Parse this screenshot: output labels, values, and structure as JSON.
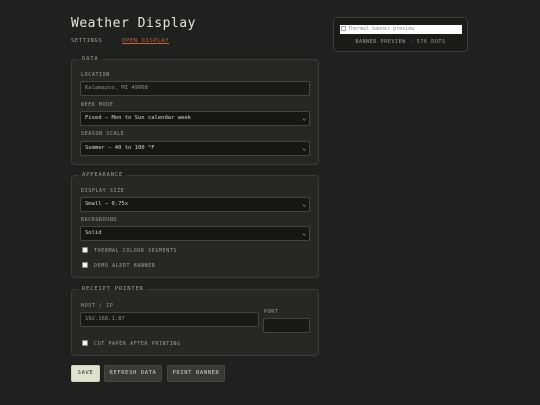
{
  "page": {
    "title": "Weather Display"
  },
  "breadcrumb": {
    "settings": "SETTINGS",
    "separator": "·",
    "open_display": "OPEN DISPLAY"
  },
  "data_section": {
    "legend": "DATA",
    "location_label": "LOCATION",
    "location_placeholder": "Kalamazoo, MI 49008",
    "week_mode_label": "WEEK MODE",
    "week_mode_value": "Fixed — Mon to Sun calendar week",
    "season_scale_label": "SEASON SCALE",
    "season_scale_value": "Summer — 40 to 100 °F"
  },
  "appearance_section": {
    "legend": "APPEARANCE",
    "display_size_label": "DISPLAY SIZE",
    "display_size_value": "Small — 0.75x",
    "background_label": "BACKGROUND",
    "background_value": "Solid",
    "thermal_colour_label": "THERMAL COLOUR SEGMENTS",
    "demo_alert_label": "DEMO ALERT BANNER"
  },
  "printer_section": {
    "legend": "RECEIPT PRINTER",
    "host_label": "HOST / IP",
    "host_placeholder": "192.168.1.87",
    "port_label": "PORT",
    "port_value": "",
    "cut_paper_label": "CUT PAPER AFTER PRINTING"
  },
  "actions": {
    "save": "SAVE",
    "refresh": "REFRESH DATA",
    "print": "PRINT BANNER"
  },
  "preview": {
    "image_alt": "Thermal banner preview",
    "caption_left": "BANNER PREVIEW",
    "caption_sep": "·",
    "caption_right": "576 DOTS"
  },
  "icons": {
    "select_arrow": "chevron-down-icon",
    "broken_image": "broken-image-icon"
  },
  "colors": {
    "background": "#1f211e",
    "accent_link": "#c8623c",
    "primary_button": "#dfe2cc"
  }
}
